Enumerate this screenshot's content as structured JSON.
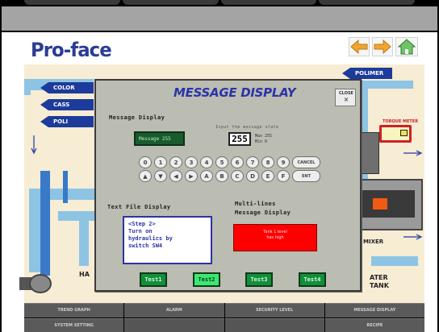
{
  "brand": {
    "logo": "Pro-face"
  },
  "nav": {
    "back_icon": "arrow-left-icon",
    "forward_icon": "arrow-right-icon",
    "home_icon": "home-icon"
  },
  "plant": {
    "tags": [
      "COLOR",
      "CASS",
      "POLI",
      "POLIMER"
    ],
    "indicator_label": "TORQUE METER",
    "mixer_label": "MIXER",
    "left_label": "HA",
    "right_label": "ATER\nTANK"
  },
  "modal": {
    "title": "MESSAGE DISPLAY",
    "close_label": "CLOSE",
    "message_display_label": "Message Display",
    "message_value": "Message 255",
    "input_hint": "Input the message state",
    "input_value": "255",
    "max_min": "Max 255\nMin 0",
    "keypad": {
      "row1": [
        "0",
        "1",
        "2",
        "3",
        "4",
        "5",
        "6",
        "7",
        "8",
        "9"
      ],
      "row1_wide": "CANCEL",
      "row2": [
        "▲",
        "▼",
        "◀",
        "▶",
        "A",
        "B",
        "C",
        "D",
        "E",
        "F"
      ],
      "row2_wide": "ENT"
    },
    "text_file_label": "Text File Display",
    "text_file_content": "<Step 2>\nTurn on\nhydraulics by\nswitch SW4",
    "multi_label": "Multi-lines\nMessage Display",
    "multi_content": "Tank 1 level\nhas high",
    "buttons": [
      "Test1",
      "Test2",
      "Test3",
      "Test4"
    ],
    "active_button": "Test2"
  },
  "bottom_menu": [
    "TREND GRAPH",
    "ALARM",
    "SECURITY LEVEL",
    "MESSAGE DISPLAY",
    "SYSTEM SETTING",
    "",
    "",
    "RECIPE"
  ],
  "colors": {
    "brand": "#2a3d95",
    "title": "#2b33a8",
    "button_green": "#128f3a",
    "alert_red": "#ff0000"
  }
}
